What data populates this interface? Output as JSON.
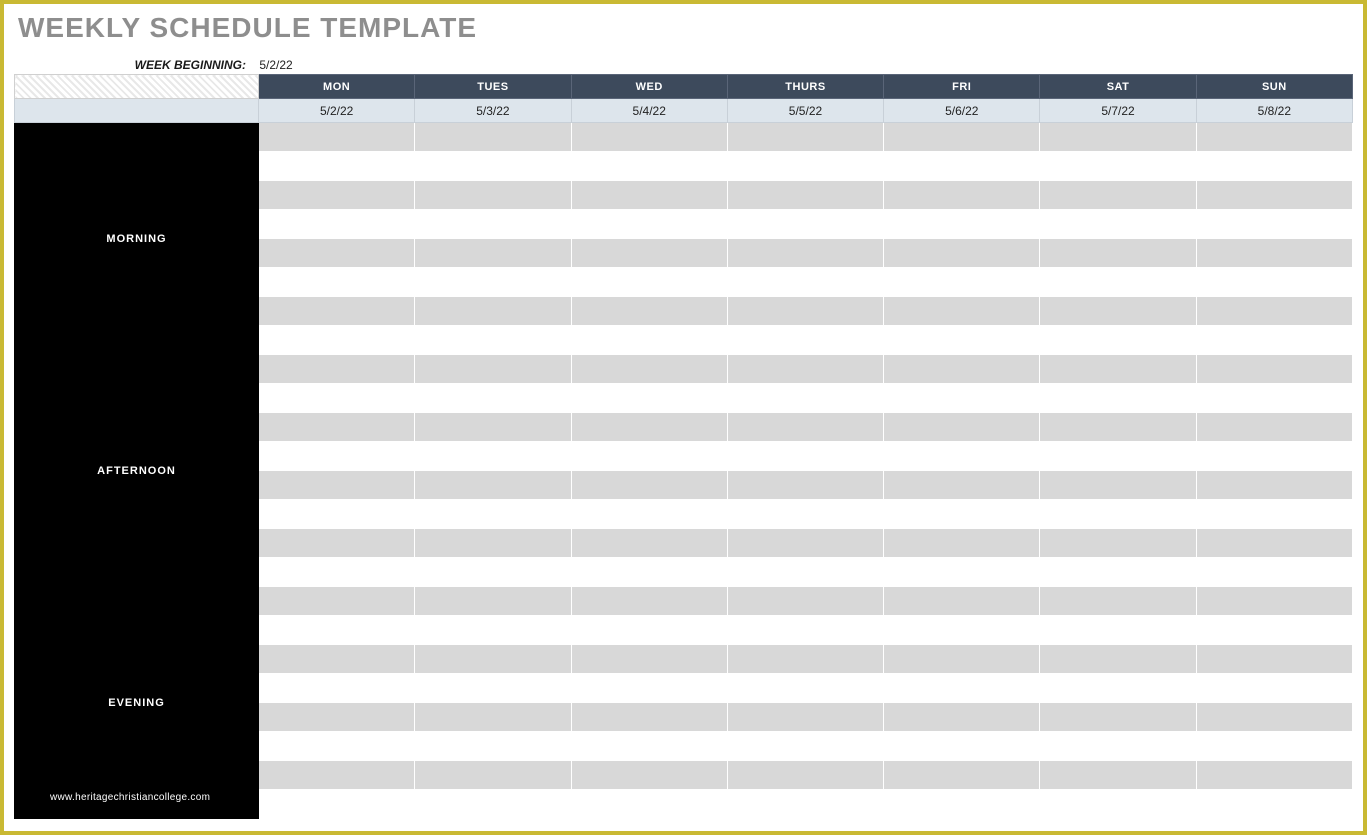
{
  "title": "WEEKLY SCHEDULE TEMPLATE",
  "week_label": "WEEK BEGINNING:",
  "week_value": "5/2/22",
  "days": [
    {
      "name": "MON",
      "date": "5/2/22"
    },
    {
      "name": "TUES",
      "date": "5/3/22"
    },
    {
      "name": "WED",
      "date": "5/4/22"
    },
    {
      "name": "THURS",
      "date": "5/5/22"
    },
    {
      "name": "FRI",
      "date": "5/6/22"
    },
    {
      "name": "SAT",
      "date": "5/7/22"
    },
    {
      "name": "SUN",
      "date": "5/8/22"
    }
  ],
  "periods": [
    {
      "label": "MORNING",
      "rows": 8
    },
    {
      "label": "AFTERNOON",
      "rows": 8
    },
    {
      "label": "EVENING",
      "rows": 8
    }
  ],
  "watermark": "www.heritagechristiancollege.com"
}
